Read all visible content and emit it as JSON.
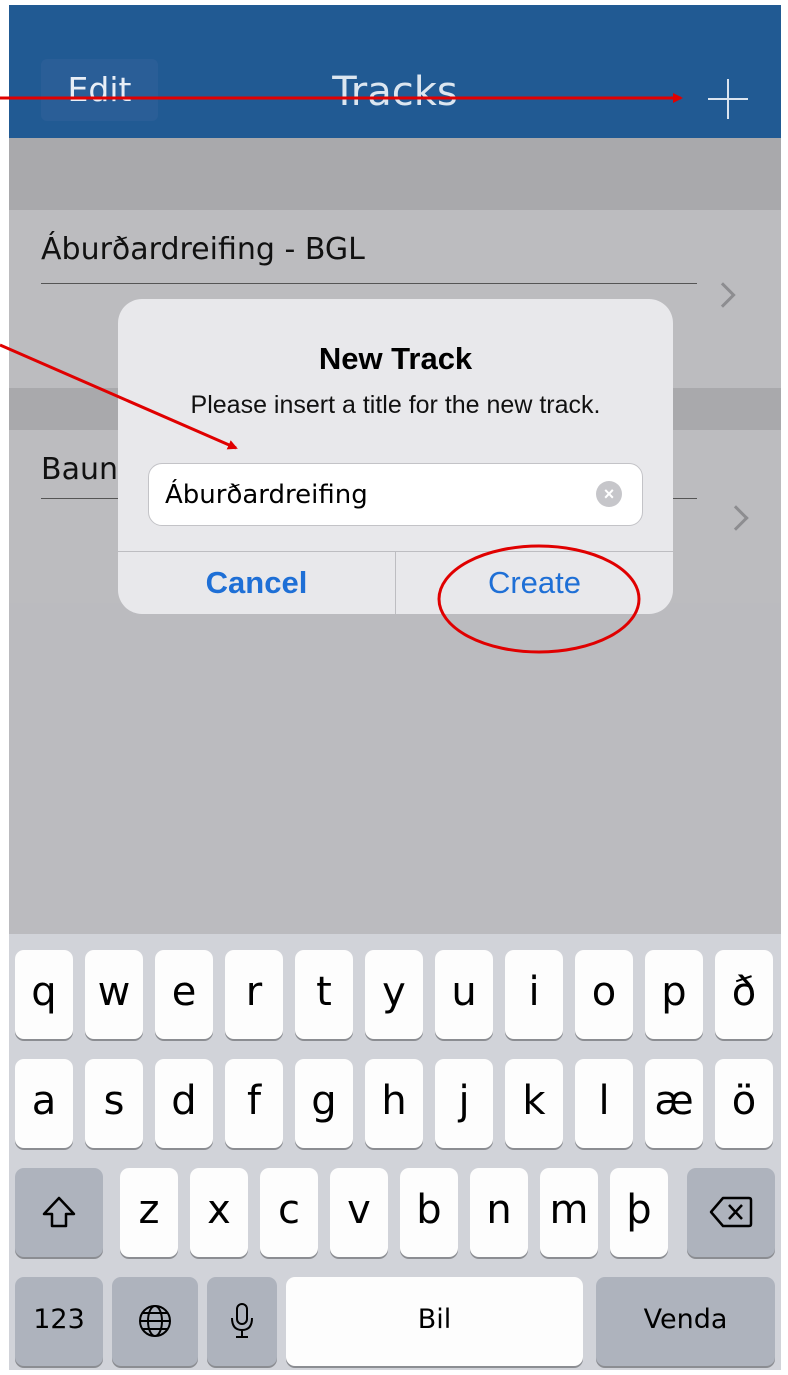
{
  "nav": {
    "edit": "Edit",
    "title": "Tracks",
    "add_icon": "plus-icon"
  },
  "tracks": [
    {
      "title": "Áburðardreifing - BGL"
    },
    {
      "title": "Bauna"
    }
  ],
  "dialog": {
    "title": "New Track",
    "message": "Please insert a title for the new track.",
    "input_value": "Áburðardreifing",
    "clear_icon": "clear-circle-icon",
    "cancel": "Cancel",
    "create": "Create"
  },
  "keyboard": {
    "row1": [
      "q",
      "w",
      "e",
      "r",
      "t",
      "y",
      "u",
      "i",
      "o",
      "p",
      "ð"
    ],
    "row2": [
      "a",
      "s",
      "d",
      "f",
      "g",
      "h",
      "j",
      "k",
      "l",
      "æ",
      "ö"
    ],
    "row3": [
      "z",
      "x",
      "c",
      "v",
      "b",
      "n",
      "m",
      "þ"
    ],
    "numbers": "123",
    "space": "Bil",
    "return": "Venda",
    "shift_icon": "shift-icon",
    "delete_icon": "delete-icon",
    "globe_icon": "globe-icon",
    "mic_icon": "microphone-icon"
  },
  "annotation_color": "#e00000"
}
